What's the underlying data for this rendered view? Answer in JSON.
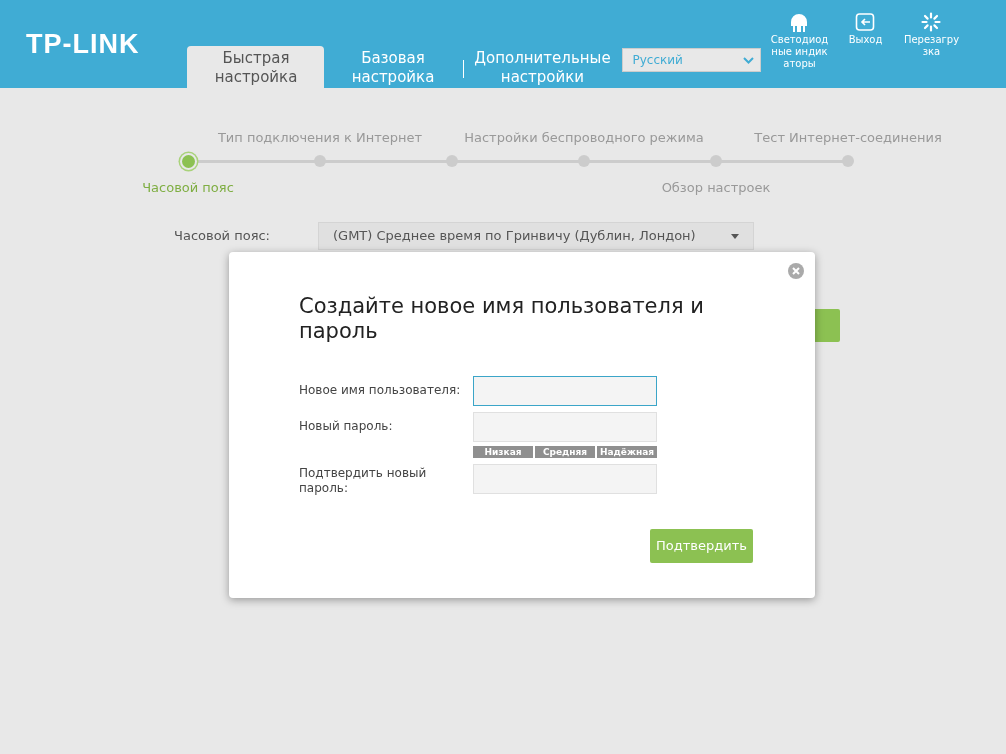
{
  "header": {
    "logo": "TP-LINK",
    "tabs": [
      {
        "label": "Быстрая настройка",
        "selected": true
      },
      {
        "label": "Базовая настройка",
        "selected": false
      },
      {
        "label": "Дополнительные настройки",
        "selected": false
      }
    ],
    "language": {
      "value": "Русский"
    },
    "tools": [
      {
        "kind": "led",
        "label": "Светодиодные индикаторы"
      },
      {
        "kind": "logout",
        "label": "Выход"
      },
      {
        "kind": "reboot",
        "label": "Перезагрузка"
      }
    ]
  },
  "steps": [
    {
      "label": "Часовой пояс",
      "kind": "below",
      "selected": true
    },
    {
      "label": "Тип подключения к Интернет",
      "kind": "above",
      "selected": false
    },
    {
      "selected": false
    },
    {
      "label": "Настройки беспроводного режима",
      "kind": "above",
      "selected": false
    },
    {
      "label": "Обзор настроек",
      "kind": "below",
      "selected": false
    },
    {
      "label": "Тест Интернет-соединения",
      "kind": "above",
      "selected": false
    }
  ],
  "timezone": {
    "label": "Часовой пояс:",
    "value": "(GMT) Среднее время по Гринвичу (Дублин, Лондон)"
  },
  "dialog": {
    "title": "Создайте новое имя пользователя и пароль",
    "fields": [
      {
        "label": "Новое имя пользователя:",
        "focused": true
      },
      {
        "label": "Новый пароль:",
        "focused": false,
        "strength": [
          "Низкая",
          "Средняя",
          "Надёжная"
        ]
      },
      {
        "label": "Подтвердить новый пароль:",
        "focused": false
      }
    ],
    "confirm": "Подтвердить"
  }
}
